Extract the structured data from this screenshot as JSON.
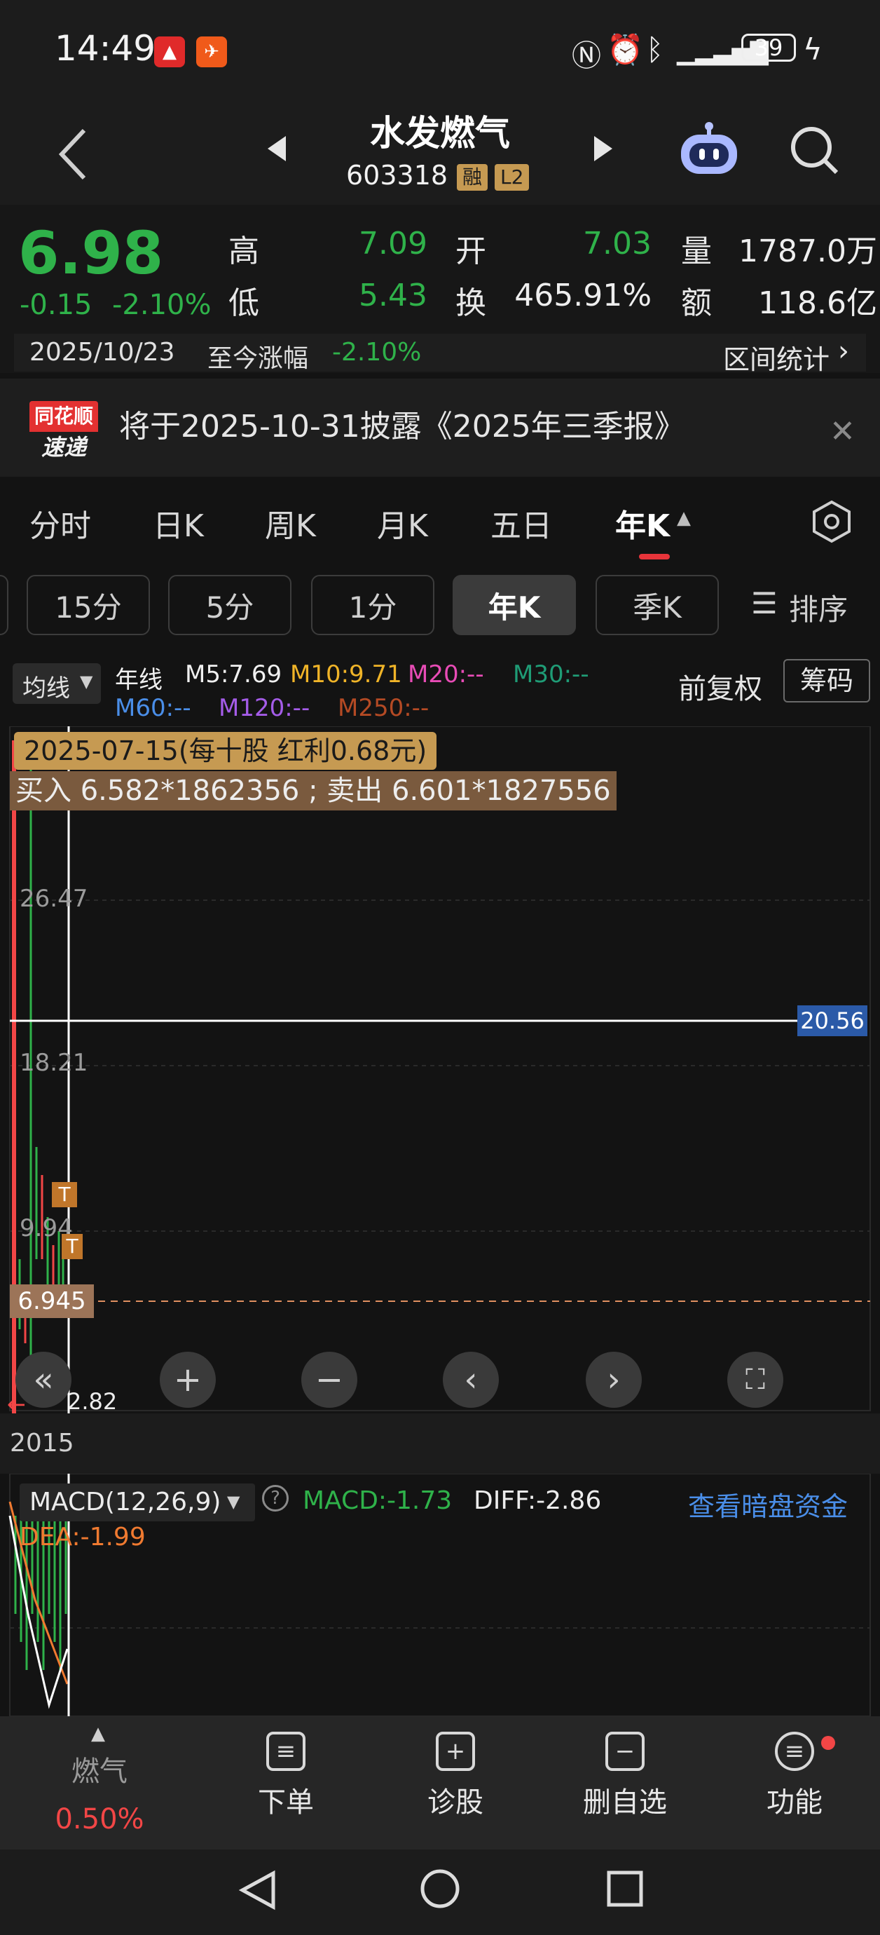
{
  "status": {
    "time": "14:49",
    "battery": "39"
  },
  "header": {
    "name": "水发燃气",
    "code": "603318",
    "tag1": "融",
    "tag2": "L2"
  },
  "quote": {
    "price": "6.98",
    "change": "-0.15",
    "change_pct": "-2.10%",
    "high_label": "高",
    "high": "7.09",
    "low_label": "低",
    "low": "5.43",
    "open_label": "开",
    "open": "7.03",
    "turnover_label": "换",
    "turnover": "465.91%",
    "volume_label": "量",
    "volume": "1787.0万",
    "amount_label": "额",
    "amount": "118.6亿",
    "date": "2025/10/23",
    "since_label": "至今涨幅",
    "since": "-2.10%",
    "range_stats": "区间统计"
  },
  "announce": {
    "logo_top": "同花顺",
    "logo_bottom": "速递",
    "text": "将于2025-10-31披露《2025年三季报》"
  },
  "period_tabs": [
    "分时",
    "日K",
    "周K",
    "月K",
    "五日",
    "年K"
  ],
  "sub_tabs": [
    "15分",
    "5分",
    "1分",
    "年K",
    "季K"
  ],
  "sort_label": "排序",
  "ma": {
    "mode": "均线",
    "type": "年线",
    "m5": "M5:7.69",
    "m10": "M10:9.71",
    "m20": "M20:--",
    "m30": "M30:--",
    "m60": "M60:--",
    "m120": "M120:--",
    "m250": "M250:--",
    "adjust": "前复权",
    "chips": "筹码"
  },
  "chart": {
    "dividend": "2025-07-15(每十股 红利0.68元)",
    "trade": "买入 6.582*1862356 ; 卖出 6.601*1827556",
    "y_ticks": [
      "26.47",
      "18.21",
      "9.94"
    ],
    "crosshair_value": "20.56",
    "current_price_tag": "6.945",
    "min_label": "2.82",
    "year_label": "2015",
    "t_mark": "T",
    "colors": {
      "up": "#f24646",
      "down": "#2fb24a"
    }
  },
  "macd": {
    "name": "MACD(12,26,9)",
    "macd": "MACD:-1.73",
    "diff": "DIFF:-2.86",
    "dea": "DEA:-1.99",
    "link": "查看暗盘资金"
  },
  "nav": {
    "sector": "燃气",
    "sector_pct": "0.50%",
    "order": "下单",
    "diagnose": "诊股",
    "remove": "删自选",
    "more": "功能"
  }
}
